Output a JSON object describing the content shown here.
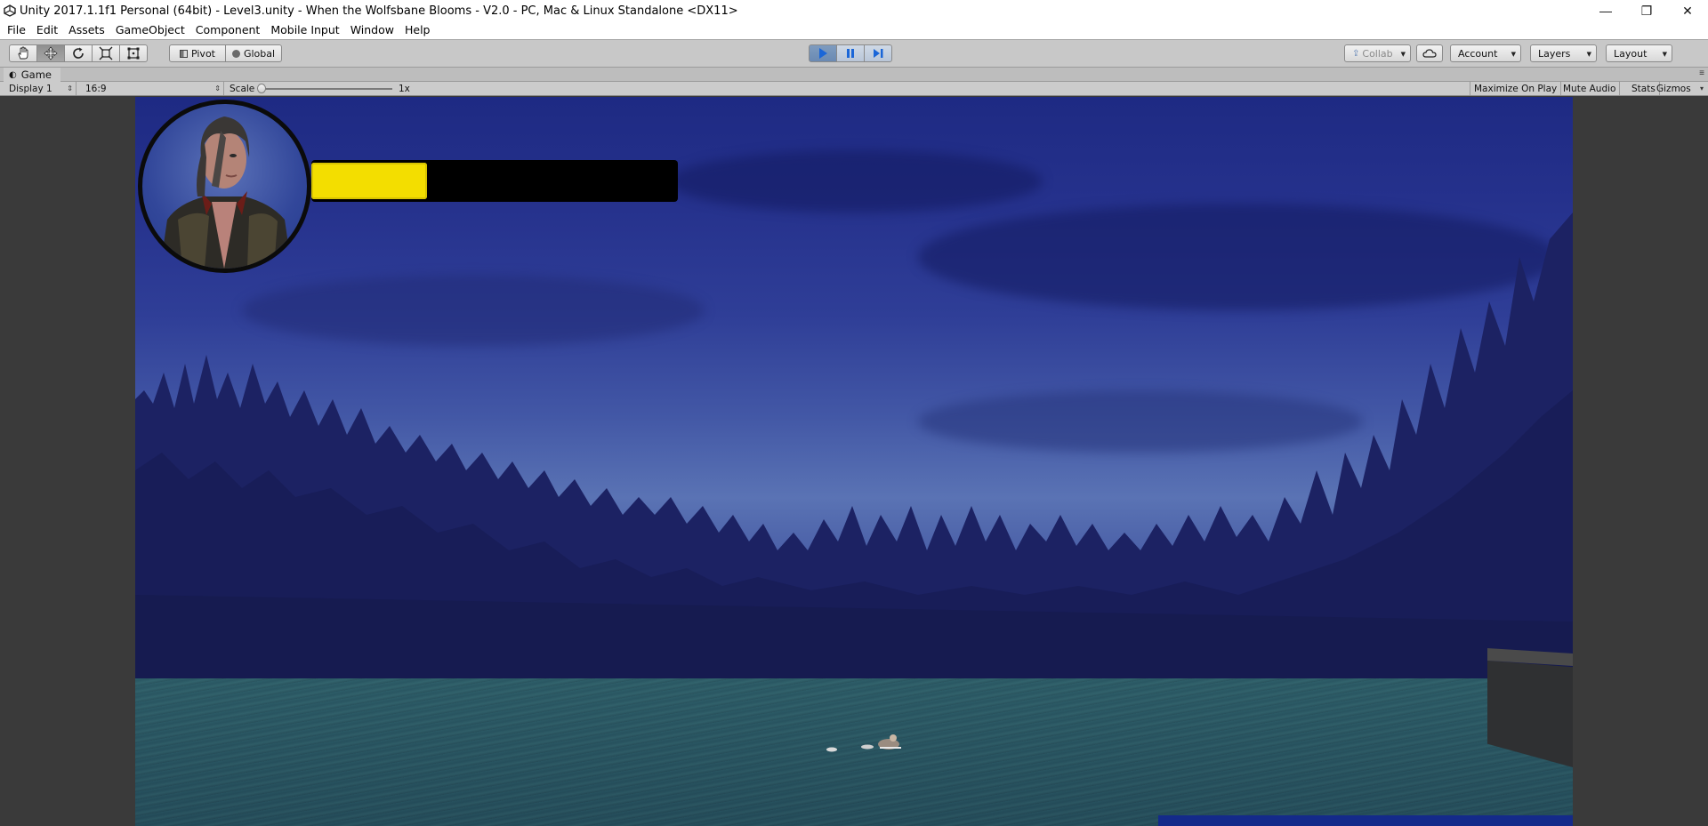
{
  "window": {
    "title": "Unity 2017.1.1f1 Personal (64bit) - Level3.unity - When the Wolfsbane Blooms - V2.0 - PC, Mac & Linux Standalone <DX11>",
    "minimize_glyph": "—",
    "maximize_glyph": "❐",
    "close_glyph": "✕"
  },
  "menu": {
    "items": [
      "File",
      "Edit",
      "Assets",
      "GameObject",
      "Component",
      "Mobile Input",
      "Window",
      "Help"
    ]
  },
  "toolbar": {
    "tools": [
      "hand-icon",
      "move-icon",
      "rotate-icon",
      "scale-icon",
      "rect-transform-icon"
    ],
    "selected_tool": "move-icon",
    "pivot_label": "Pivot",
    "global_label": "Global",
    "play_state": "playing",
    "collab_label": "Collab",
    "account_label": "Account",
    "layers_label": "Layers",
    "layout_label": "Layout"
  },
  "game_view": {
    "tab_label": "Game",
    "display_label": "Display 1",
    "aspect_label": "16:9",
    "scale_label": "Scale",
    "scale_value": "1x",
    "scale_level": 0,
    "maximize_label": "Maximize On Play",
    "mute_label": "Mute Audio",
    "stats_label": "Stats",
    "gizmos_label": "Gizmos"
  },
  "hud": {
    "health_fraction": 0.32,
    "health_color": "#f3de00"
  },
  "colors": {
    "sky_top": "#1e2a83",
    "water": "#2f5f6a",
    "play_active": "#6a8ab3"
  }
}
